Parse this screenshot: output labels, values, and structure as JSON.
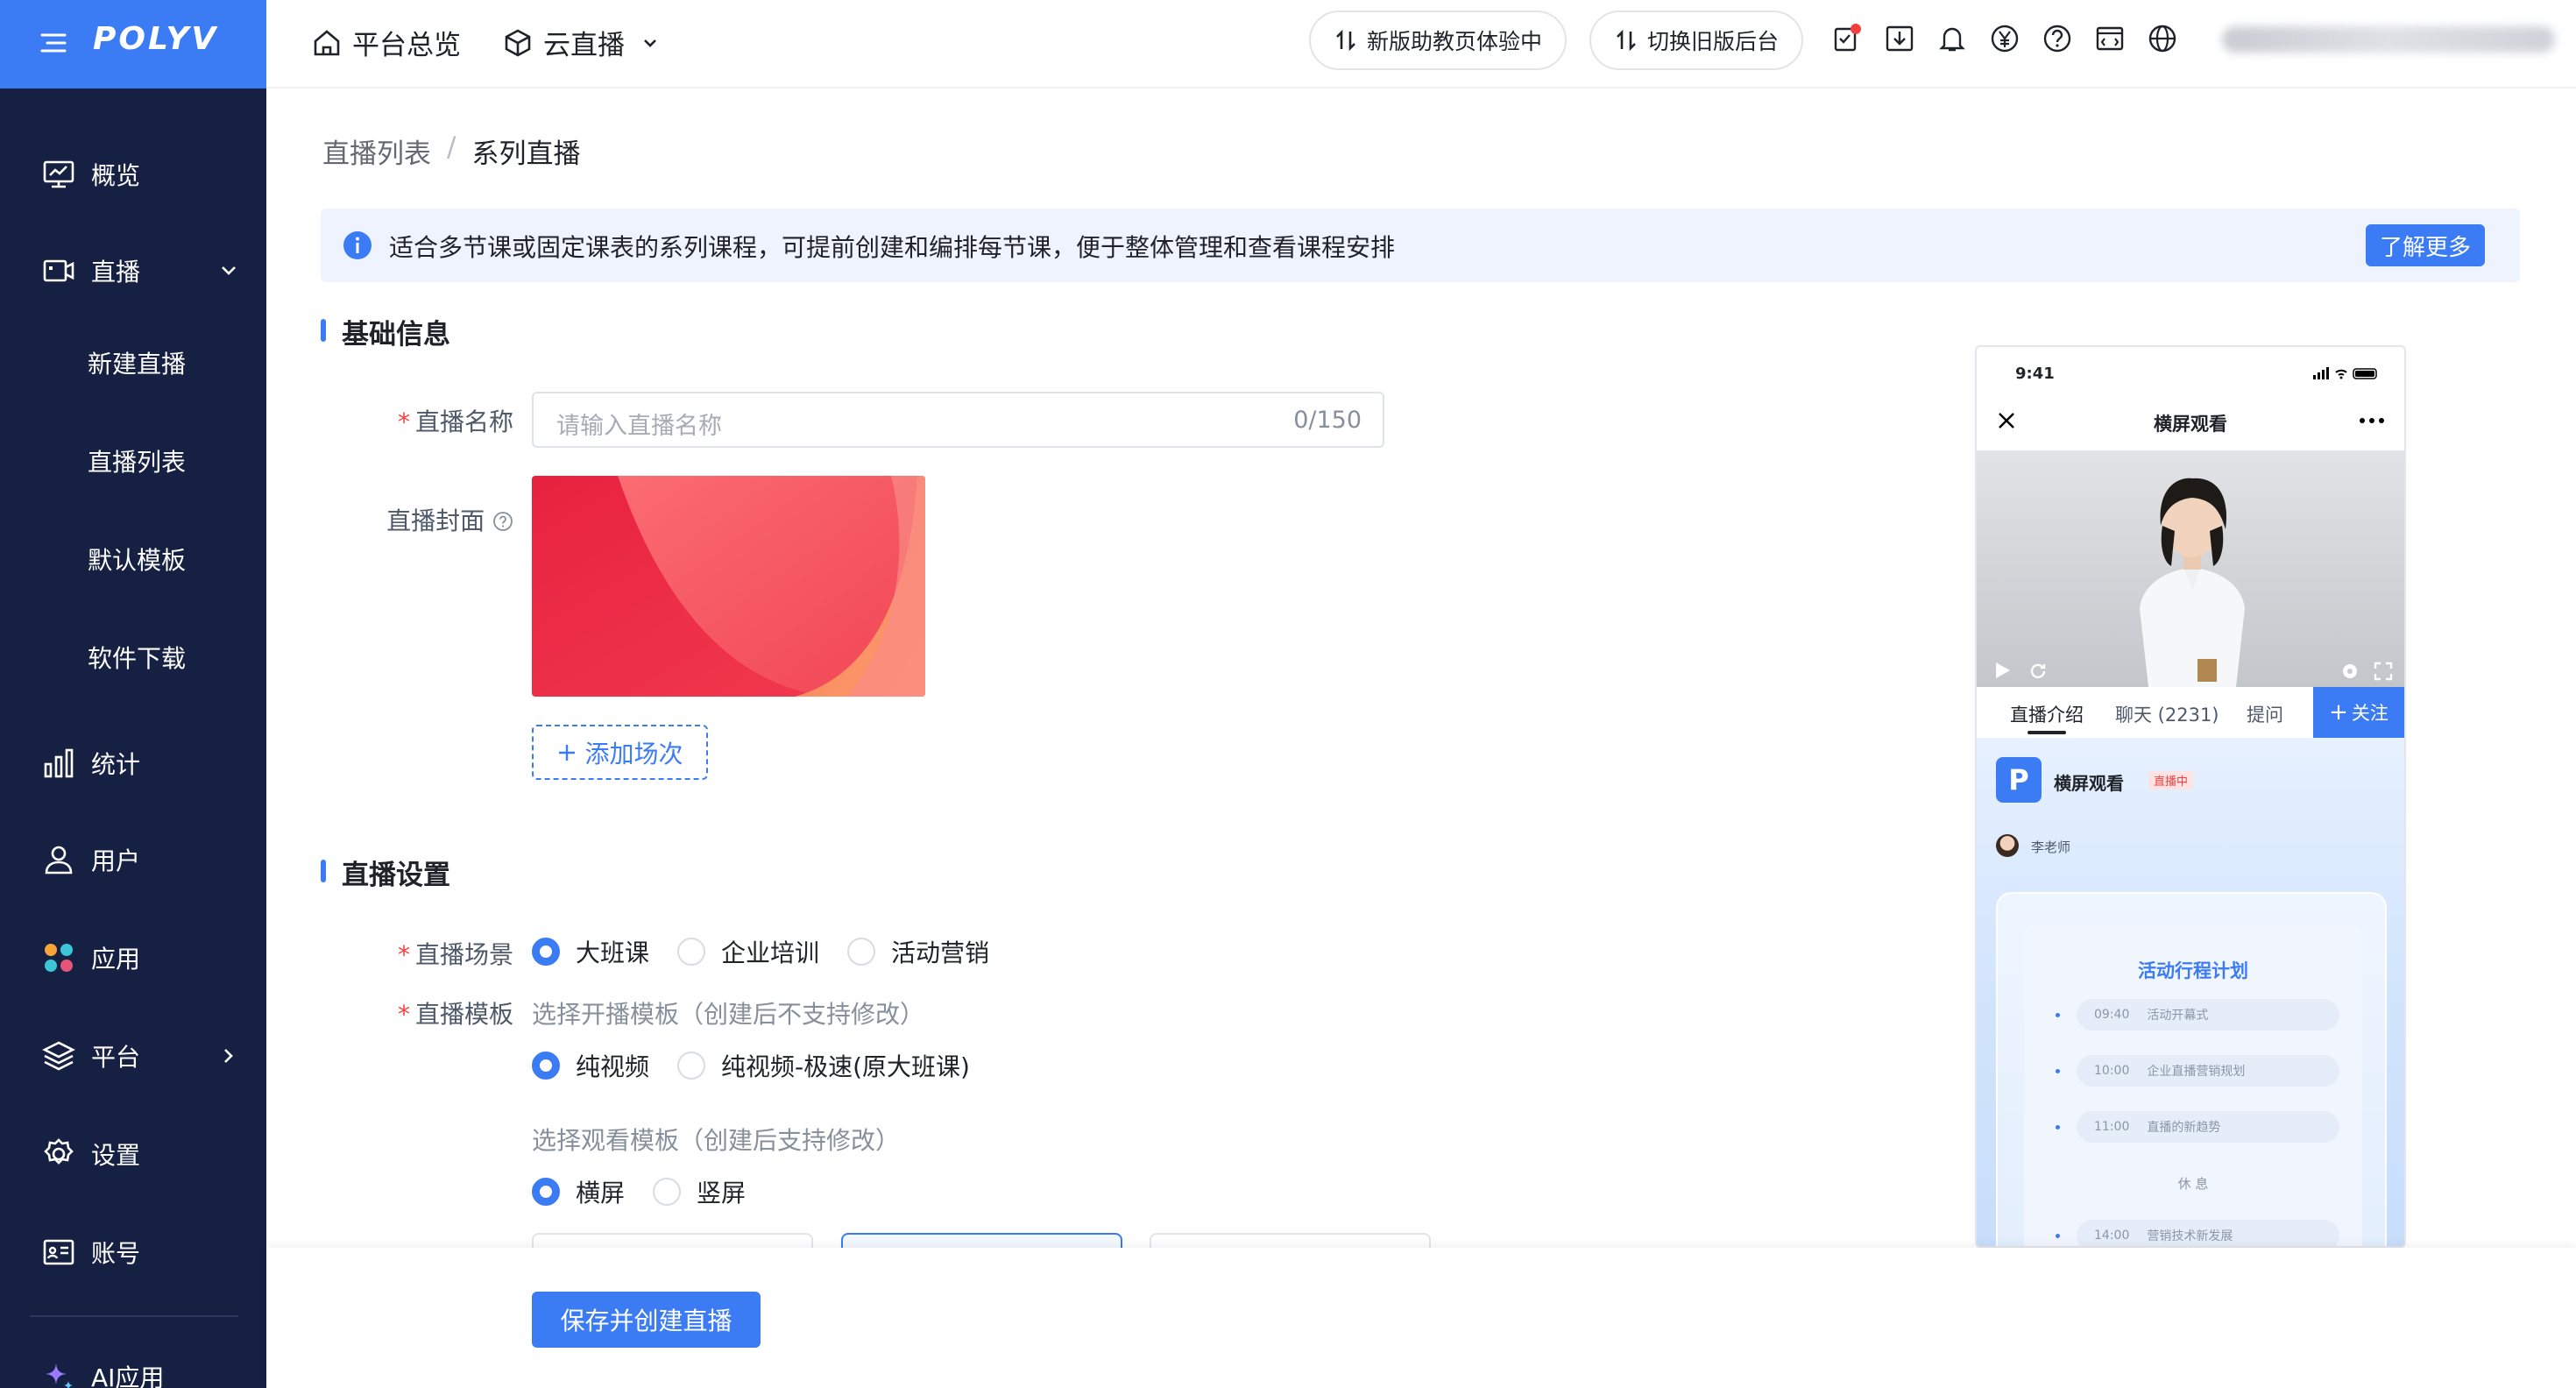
{
  "brand": {
    "logo": "POLYV",
    "accent": "#3b7cf4",
    "sidebar_bg": "#162043"
  },
  "sidebar": {
    "items": [
      {
        "label": "概览",
        "icon": "monitor-icon"
      },
      {
        "label": "直播",
        "icon": "video-camera-icon",
        "expanded": true
      },
      {
        "label": "统计",
        "icon": "bar-chart-icon"
      },
      {
        "label": "用户",
        "icon": "user-icon"
      },
      {
        "label": "应用",
        "icon": "apps-icon"
      },
      {
        "label": "平台",
        "icon": "layers-icon"
      },
      {
        "label": "设置",
        "icon": "gear-icon"
      },
      {
        "label": "账号",
        "icon": "id-card-icon"
      },
      {
        "label": "AI应用",
        "icon": "sparkle-icon"
      }
    ],
    "live_sub": [
      "新建直播",
      "直播列表",
      "默认模板",
      "软件下载"
    ]
  },
  "topbar": {
    "home": "平台总览",
    "product": "云直播",
    "pill_new": "新版助教页体验中",
    "pill_old": "切换旧版后台",
    "icons": [
      "task-icon",
      "download-icon",
      "bell-icon",
      "yuan-icon",
      "help-icon",
      "code-icon",
      "globe-icon"
    ]
  },
  "breadcrumb": {
    "parent": "直播列表",
    "separator": "/",
    "current": "系列直播"
  },
  "notice": {
    "text": "适合多节课或固定课表的系列课程，可提前创建和编排每节课，便于整体管理和查看课程安排",
    "button": "了解更多"
  },
  "basic": {
    "title": "基础信息",
    "name_label": "直播名称",
    "name_placeholder": "请输入直播名称",
    "name_count": "0/150",
    "cover_label": "直播封面",
    "add_session": "添加场次"
  },
  "settings": {
    "title": "直播设置",
    "scene_label": "直播场景",
    "scenes": [
      "大班课",
      "企业培训",
      "活动营销"
    ],
    "scene_selected": "大班课",
    "template_label": "直播模板",
    "start_hint": "选择开播模板（创建后不支持修改）",
    "start_templates": [
      "纯视频",
      "纯视频-极速(原大班课)"
    ],
    "start_selected": "纯视频",
    "watch_hint": "选择观看模板（创建后支持修改）",
    "watch_templates": [
      "横屏",
      "竖屏"
    ],
    "watch_selected": "横屏"
  },
  "footer": {
    "save": "保存并创建直播"
  },
  "phone": {
    "time": "9:41",
    "header": "横屏观看",
    "tabs": [
      "直播介绍",
      "聊天 (2231)",
      "提问"
    ],
    "follow": "关注",
    "room_title": "横屏观看",
    "live_badge": "直播中",
    "teacher": "李老师",
    "plan_title": "活动行程计划",
    "schedule": [
      {
        "time": "09:40",
        "item": "活动开幕式"
      },
      {
        "time": "10:00",
        "item": "企业直播营销规划"
      },
      {
        "time": "11:00",
        "item": "直播的新趋势"
      }
    ],
    "break_label": "休 息",
    "schedule2": {
      "time": "14:00",
      "item": "营销技术新发展"
    }
  }
}
